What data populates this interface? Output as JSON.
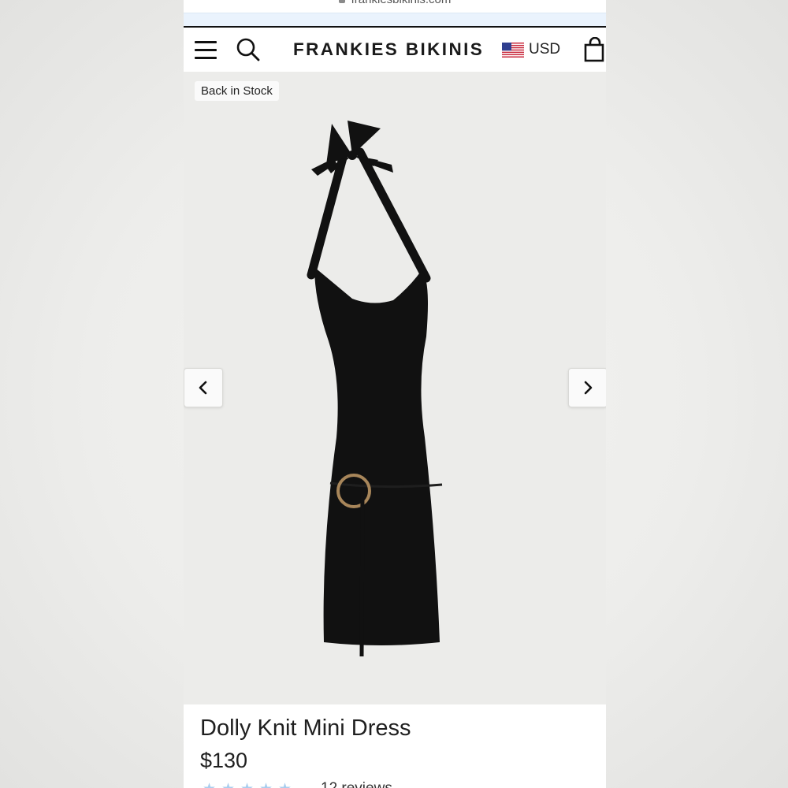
{
  "browser": {
    "url": "frankiesbikinis.com"
  },
  "header": {
    "logo": "FRANKIES BIKINIS",
    "currency": "USD",
    "icons": [
      "hamburger-menu-icon",
      "search-icon",
      "us-flag-icon",
      "shopping-bag-icon"
    ]
  },
  "gallery": {
    "badge": "Back in Stock",
    "prev_icon": "chevron-left-icon",
    "next_icon": "chevron-right-icon"
  },
  "product": {
    "title": "Dolly Knit Mini Dress",
    "price": "$130",
    "rating_stars": 5,
    "review_count": "12 reviews"
  },
  "colors": {
    "background": "#ececea",
    "header_border": "#111111",
    "star": "#a9cdee",
    "dress": "#111111",
    "ring": "#a8865a"
  }
}
